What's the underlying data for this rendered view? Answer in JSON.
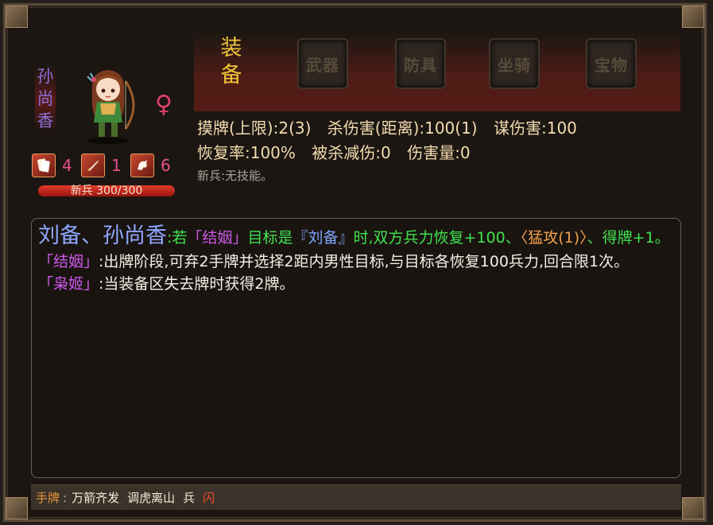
{
  "hero": {
    "name": "孙尚香",
    "name_chars": [
      "孙",
      "尚",
      "香"
    ],
    "gender_symbol": "♀",
    "stats": [
      {
        "icon": "card-icon",
        "value": "4"
      },
      {
        "icon": "sword-icon",
        "value": "1"
      },
      {
        "icon": "horse-icon",
        "value": "6"
      }
    ],
    "hp_label": "新兵 300/300",
    "hp_fraction": 1.0
  },
  "equipment": {
    "title_chars": [
      "装",
      "备"
    ],
    "slots": [
      "武器",
      "防具",
      "坐骑",
      "宝物"
    ]
  },
  "attributes": {
    "line1": [
      "摸牌(上限):2(3)",
      "杀伤害(距离):100(1)",
      "谋伤害:100"
    ],
    "line2": [
      "恢复率:100%",
      "被杀减伤:0",
      "伤害量:0"
    ],
    "skill_note": "新兵:无技能。"
  },
  "description": {
    "combo_names": "刘备、孙尚香",
    "combo_colon": ":",
    "combo_text_1": "若",
    "combo_skill": "「结姻」",
    "combo_text_2": "目标是",
    "combo_target": "『刘备』",
    "combo_text_3": "时,双方兵力恢复+100、",
    "combo_effect": "〈猛攻(1)〉",
    "combo_text_4": "、得牌+1。",
    "skills": [
      {
        "name": "「结姻」",
        "text": ":出牌阶段,可弃2手牌并选择2距内男性目标,与目标各恢复100兵力,回合限1次。"
      },
      {
        "name": "「枭姬」",
        "text": ":当装备区失去牌时获得2牌。"
      }
    ]
  },
  "hand": {
    "label": "手牌",
    "separator": ":",
    "cards": [
      "万箭齐发",
      "调虎离山",
      "兵",
      "闪"
    ]
  }
}
